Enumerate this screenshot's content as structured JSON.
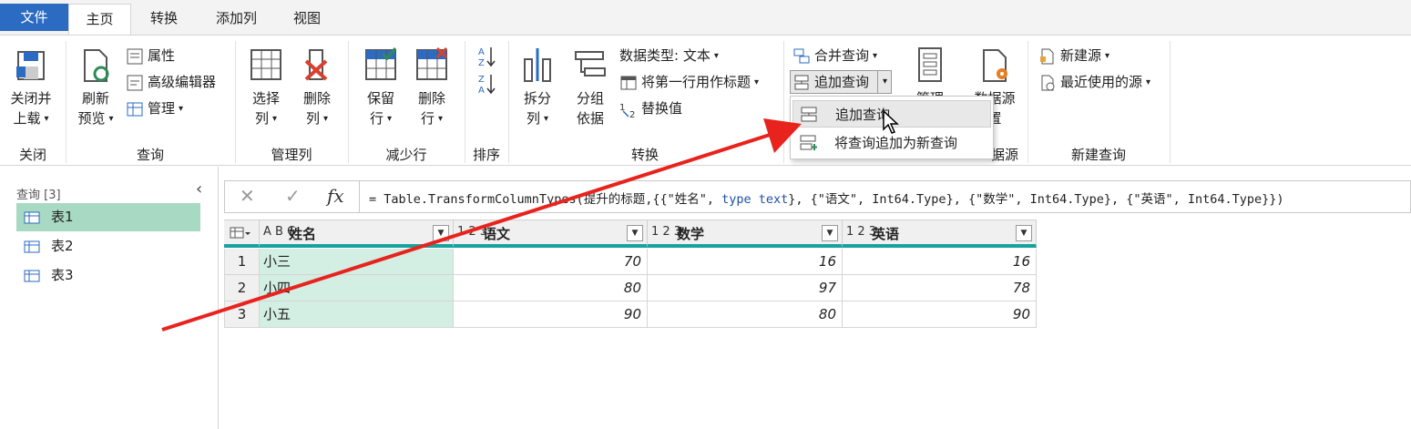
{
  "tabs": [
    {
      "label": "文件"
    },
    {
      "label": "主页"
    },
    {
      "label": "转换"
    },
    {
      "label": "添加列"
    },
    {
      "label": "视图"
    }
  ],
  "ribbon": {
    "close": {
      "btn_line1": "关闭并",
      "btn_line2": "上载",
      "group": "关闭"
    },
    "query": {
      "refresh_line1": "刷新",
      "refresh_line2": "预览",
      "properties": "属性",
      "advanced_editor": "高级编辑器",
      "manage": "管理",
      "group": "查询"
    },
    "manage_cols": {
      "choose_line1": "选择",
      "choose_line2": "列",
      "remove_line1": "删除",
      "remove_line2": "列",
      "group": "管理列"
    },
    "reduce_rows": {
      "keep_line1": "保留",
      "keep_line2": "行",
      "remove_line1": "删除",
      "remove_line2": "行",
      "group": "减少行"
    },
    "sort": {
      "group": "排序"
    },
    "transform": {
      "split_line1": "拆分",
      "split_line2": "列",
      "group_line1": "分组",
      "group_line2": "依据",
      "datatype": "数据类型: 文本",
      "first_row_header": "将第一行用作标题",
      "replace": "替换值",
      "group": "转换"
    },
    "combine": {
      "merge": "合并查询",
      "append": "追加查询",
      "manage_partial": "管理",
      "group_partial": "据源"
    },
    "datasource": {
      "line1": "数据源",
      "line2": "置"
    },
    "new_query": {
      "new_source": "新建源",
      "recent_source": "最近使用的源",
      "group": "新建查询"
    }
  },
  "dropdown": {
    "items": [
      "追加查询",
      "将查询追加为新查询"
    ]
  },
  "left_pane": {
    "title": "查询 [3]",
    "queries": [
      "表1",
      "表2",
      "表3"
    ]
  },
  "formula": {
    "prefix": "= Table.TransformColumnTypes(提升的标题,{{\"姓名\", ",
    "kw1": "type text",
    "rest": "}, {\"语文\", Int64.Type}, {\"数学\", Int64.Type}, {\"英语\", Int64.Type}})"
  },
  "table": {
    "columns": [
      {
        "type": "A B C",
        "name": "姓名"
      },
      {
        "type": "1 2 3",
        "name": "语文"
      },
      {
        "type": "1 2 3",
        "name": "数学"
      },
      {
        "type": "1 2 3",
        "name": "英语"
      }
    ],
    "rows": [
      {
        "n": "1",
        "name": "小三",
        "yuwen": "70",
        "shuxue": "16",
        "yingyu": "16"
      },
      {
        "n": "2",
        "name": "小四",
        "yuwen": "80",
        "shuxue": "97",
        "yingyu": "78"
      },
      {
        "n": "3",
        "name": "小五",
        "yuwen": "90",
        "shuxue": "80",
        "yingyu": "90"
      }
    ]
  },
  "colors": {
    "accent": "#2b6bc2",
    "selected": "#a8d9c2",
    "name_col": "#d3eee2",
    "header_line": "#17a2a0",
    "arrow": "#e8231e"
  }
}
